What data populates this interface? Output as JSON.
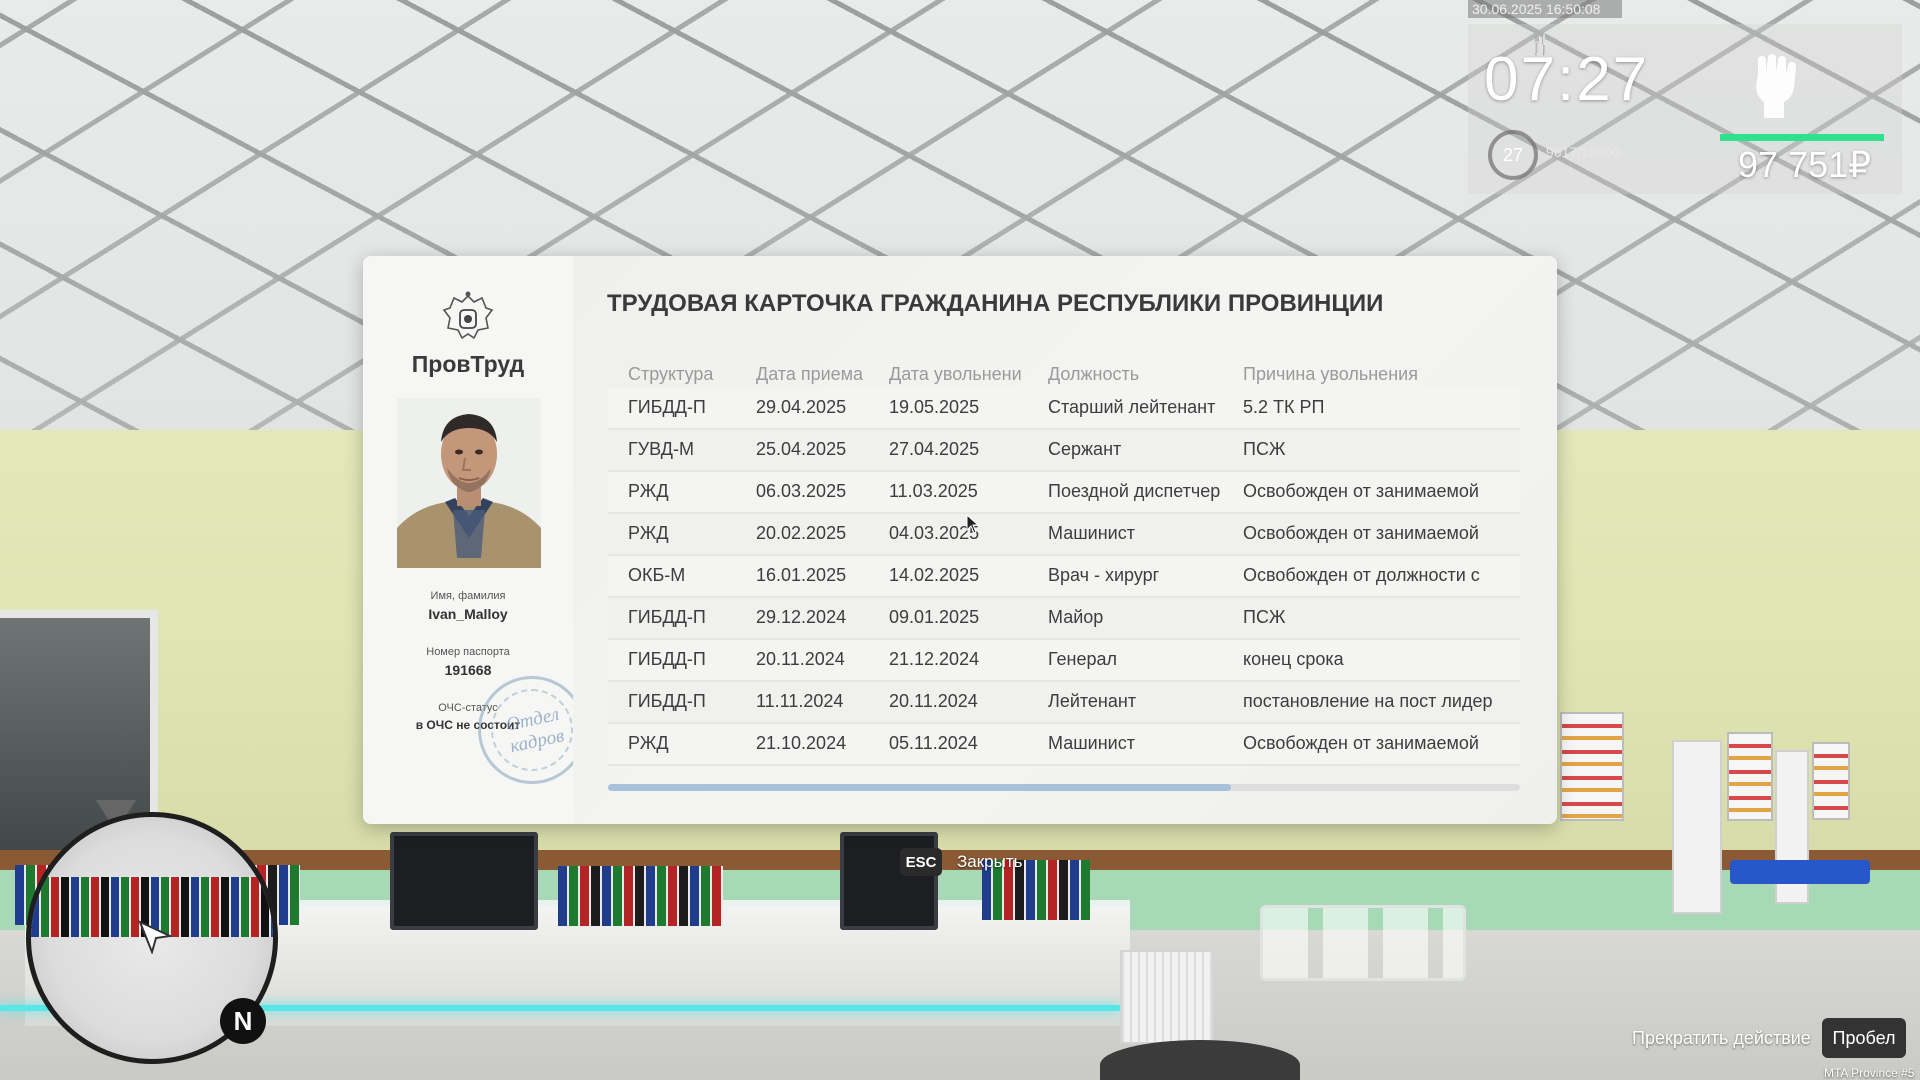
{
  "hud": {
    "datetime": "30.06.2025 16:50:08",
    "clock": "07:27",
    "level": "27",
    "xp": "9617/10800",
    "money": "97 751₽",
    "icons": {
      "food": "fork-knife-icon",
      "fist": "fist-icon"
    },
    "colors": {
      "health": "#2fe08d",
      "food": "#d23b3b"
    }
  },
  "card": {
    "org_name": "ПровТруд",
    "title": "ТРУДОВАЯ КАРТОЧКА ГРАЖДАНИНА РЕСПУБЛИКИ ПРОВИНЦИИ",
    "name_label": "Имя, фамилия",
    "name_value": "Ivan_Malloy",
    "passport_label": "Номер паспорта",
    "passport_value": "191668",
    "ochs_label": "ОЧС-статус",
    "ochs_value": "в ОЧС не состоит",
    "stamp_line1": "Отдел",
    "stamp_line2": "кадров",
    "columns": [
      "Структура",
      "Дата приема",
      "Дата увольнени",
      "Должность",
      "Причина увольнения"
    ],
    "rows": [
      [
        "ГИБДД-П",
        "29.04.2025",
        "19.05.2025",
        "Старший лейтенант",
        "5.2 ТК РП"
      ],
      [
        "ГУВД-М",
        "25.04.2025",
        "27.04.2025",
        "Сержант",
        "ПСЖ"
      ],
      [
        "РЖД",
        "06.03.2025",
        "11.03.2025",
        "Поездной диспетчер",
        "Освобожден от занимаемой"
      ],
      [
        "РЖД",
        "20.02.2025",
        "04.03.2025",
        "Машинист",
        "Освобожден от занимаемой"
      ],
      [
        "ОКБ-М",
        "16.01.2025",
        "14.02.2025",
        "Врач - хирург",
        "Освобожден от должности с"
      ],
      [
        "ГИБДД-П",
        "29.12.2024",
        "09.01.2025",
        "Майор",
        "ПСЖ"
      ],
      [
        "ГИБДД-П",
        "20.11.2024",
        "21.12.2024",
        "Генерал",
        "конец срока"
      ],
      [
        "ГИБДД-П",
        "11.11.2024",
        "20.11.2024",
        "Лейтенант",
        "постановление на пост лидер"
      ],
      [
        "РЖД",
        "21.10.2024",
        "05.11.2024",
        "Машинист",
        "Освобожден от занимаемой"
      ]
    ]
  },
  "controls": {
    "esc_key": "ESC",
    "esc_label": "Закрыть",
    "action_label": "Прекратить действие",
    "space_key": "Пробел"
  },
  "minimap": {
    "north": "N"
  },
  "server": "MTA Province #5"
}
